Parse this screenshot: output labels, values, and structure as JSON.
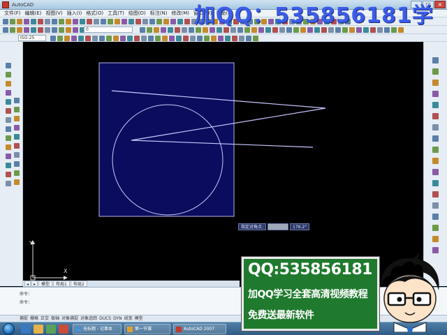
{
  "window": {
    "title": "AutoCAD",
    "controls": [
      "–",
      "□",
      "×"
    ]
  },
  "watermark": {
    "top_text": "加QQ：535856181学"
  },
  "menu": {
    "items": [
      "文件(F)",
      "编辑(E)",
      "视图(V)",
      "插入(I)",
      "格式(O)",
      "工具(T)",
      "绘图(D)",
      "标注(N)",
      "修改(M)",
      "窗口(W)",
      "帮助(H)"
    ]
  },
  "toolbar": {
    "layer_combo": "0",
    "style_combo": "ISO-25"
  },
  "canvas": {
    "background": "#000000",
    "rect_fill": "#0c0c5e",
    "line_color": "#c9c9ff"
  },
  "ucs": {
    "x_label": "X",
    "y_label": "Y"
  },
  "dynamic_input": {
    "prompt": "指定对角点:",
    "value": "",
    "angle": "176.2°"
  },
  "model_tabs": [
    "模型",
    "布局1",
    "布局2"
  ],
  "command_line": {
    "line1": "命令：",
    "line2": "命令："
  },
  "statusbar": {
    "items": [
      "捕捉",
      "栅格",
      "正交",
      "极轴",
      "对象捕捉",
      "对象追踪",
      "DUCS",
      "DYN",
      "线宽",
      "模型"
    ]
  },
  "taskbar": {
    "buttons": [
      {
        "label": "无标题 - 记事本",
        "color": "#4a90d0"
      },
      {
        "label": "第一节课",
        "color": "#e0a030"
      },
      {
        "label": "AutoCAD 2007",
        "color": "#c0392b"
      }
    ]
  },
  "promo": {
    "qq": "QQ:535856181",
    "line1": "加QQ学习全套高清视频教程",
    "line2": "免费送最新软件",
    "bg_color": "#1f7a2e"
  }
}
